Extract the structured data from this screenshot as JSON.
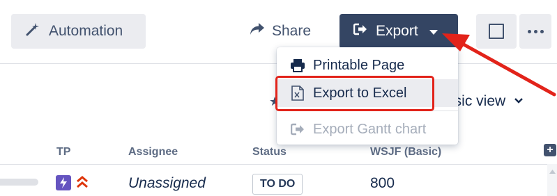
{
  "toolbar": {
    "automation_label": "Automation",
    "share_label": "Share",
    "export_label": "Export"
  },
  "export_menu": {
    "items": [
      {
        "label": "Printable Page",
        "icon": "printer-icon",
        "enabled": true
      },
      {
        "label": "Export to Excel",
        "icon": "excel-file-icon",
        "enabled": true,
        "highlighted": true
      },
      {
        "label": "Export Gantt chart",
        "icon": "export-icon",
        "enabled": false
      }
    ]
  },
  "view": {
    "label_fragment": "asic view"
  },
  "table": {
    "columns": [
      "TP",
      "Assignee",
      "Status",
      "WSJF (Basic)"
    ],
    "rows": [
      {
        "assignee": "Unassigned",
        "status": "TO DO",
        "wsjf": "800"
      }
    ]
  },
  "colors": {
    "export_button_bg": "#344563",
    "annotation_red": "#e2231a",
    "tp_icon_bg": "#6554c0",
    "priority_red": "#de350b"
  }
}
